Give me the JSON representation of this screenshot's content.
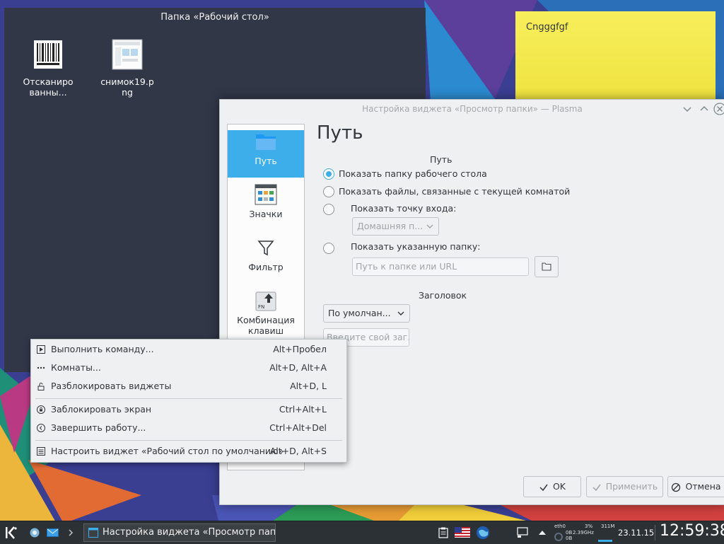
{
  "desktop": {
    "folder_widget": {
      "title": "Папка «Рабочий стол»",
      "icons": [
        {
          "label": "Отсканированны...",
          "line1": "Отсканиро",
          "line2": "ванны...",
          "icon": "barcode-file-icon"
        },
        {
          "label": "снимок19.png",
          "line1": "снимок19.p",
          "line2": "ng",
          "icon": "image-file-icon"
        }
      ]
    },
    "note": {
      "text": "Cngggfgf",
      "color": "#f3e84a"
    }
  },
  "dialog": {
    "title": "Настройка виджета «Просмотр папки» — Plasma",
    "sidebar": [
      {
        "label": "Путь",
        "icon": "folder-icon",
        "active": true
      },
      {
        "label": "Значки",
        "icon": "icons-view-icon",
        "active": false
      },
      {
        "label": "Фильтр",
        "icon": "filter-icon",
        "active": false
      },
      {
        "label": "Комбинация клавиш",
        "line1": "Комбинация",
        "line2": "клавиш",
        "icon": "keyboard-shortcut-icon",
        "active": false
      }
    ],
    "page_title": "Путь",
    "path_section": {
      "label": "Путь",
      "options": [
        {
          "label": "Показать папку рабочего стола",
          "checked": true
        },
        {
          "label": "Показать файлы, связанные с текущей комнатой",
          "checked": false
        },
        {
          "label": "Показать точку входа:",
          "checked": false
        },
        {
          "label": "Показать указанную папку:",
          "checked": false
        }
      ],
      "entry_point_value": "Домашняя п...",
      "folder_placeholder": "Путь к папке или URL"
    },
    "title_section": {
      "label": "Заголовок",
      "combo_value": "По умолчан...",
      "custom_placeholder": "Введите свой заг..."
    },
    "buttons": {
      "ok": "OK",
      "apply": "Применить",
      "cancel": "Отмена"
    },
    "accent_color": "#3daee9"
  },
  "context_menu": {
    "items": [
      {
        "label": "Выполнить команду...",
        "shortcut": "Alt+Пробел",
        "icon": "run-command-icon"
      },
      {
        "label": "Комнаты...",
        "shortcut": "Alt+D, Alt+A",
        "icon": "activities-icon"
      },
      {
        "label": "Разблокировать виджеты",
        "shortcut": "Alt+D, L",
        "icon": "unlock-icon"
      },
      {
        "label": "Заблокировать экран",
        "shortcut": "Ctrl+Alt+L",
        "icon": "lock-screen-icon"
      },
      {
        "label": "Завершить работу...",
        "shortcut": "Ctrl+Alt+Del",
        "icon": "leave-icon"
      },
      {
        "label": "Настроить виджет «Рабочий стол по умолчанию»",
        "shortcut": "Alt+D, Alt+S",
        "icon": "configure-icon"
      }
    ]
  },
  "taskbar": {
    "task_title": "Настройка виджета «Просмотр папки»",
    "date": "23.11.15",
    "time": "12:59:38",
    "sysmon": {
      "iface": "eth0",
      "cpu": "3%",
      "freq": "2.39GHz",
      "mem": "311M",
      "bps1": "0B",
      "bps2": "0B"
    }
  }
}
